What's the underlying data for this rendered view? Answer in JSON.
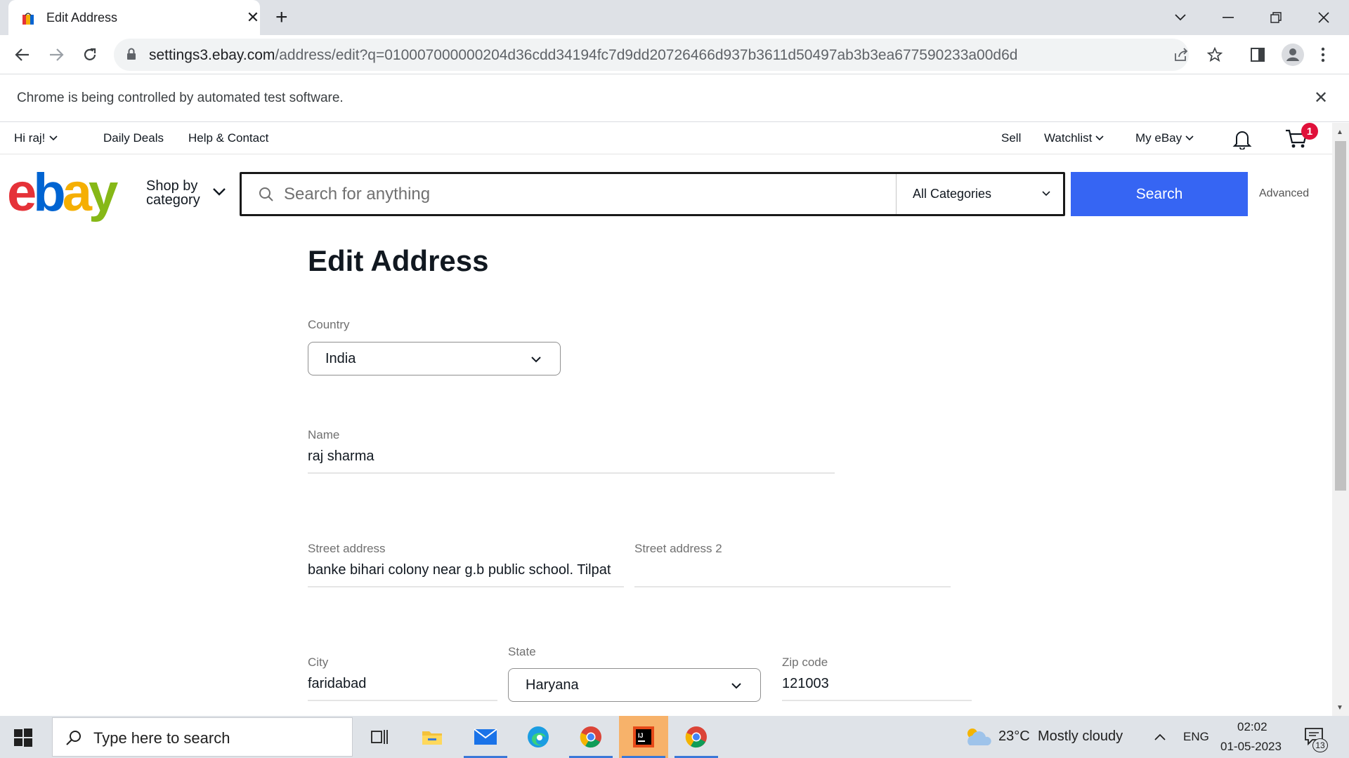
{
  "browser": {
    "tab_title": "Edit Address",
    "url_host": "settings3.ebay.com",
    "url_path": "/address/edit?q=010007000000204d36cdd34194fc7d9dd20726466d937b3611d50497ab3b3ea677590233a00d6d",
    "infobar_text": "Chrome is being controlled by automated test software."
  },
  "ebay_header": {
    "greeting": "Hi raj!",
    "links": [
      "Daily Deals",
      "Help & Contact"
    ],
    "right_links": [
      "Sell",
      "Watchlist",
      "My eBay"
    ],
    "cart_count": "1",
    "logo_letters": [
      "e",
      "b",
      "a",
      "y"
    ],
    "logo_colors": [
      "#e53238",
      "#0064d2",
      "#f5af02",
      "#86b817"
    ],
    "shop_by_line1": "Shop by",
    "shop_by_line2": "category",
    "search_placeholder": "Search for anything",
    "category_select": "All Categories",
    "search_button": "Search",
    "advanced_link": "Advanced"
  },
  "form": {
    "title": "Edit Address",
    "country": {
      "label": "Country",
      "value": "India"
    },
    "name": {
      "label": "Name",
      "value": "raj sharma"
    },
    "street1": {
      "label": "Street address",
      "value": "banke bihari colony near g.b public school. Tilpat"
    },
    "street2": {
      "label": "Street address 2",
      "value": ""
    },
    "city": {
      "label": "City",
      "value": "faridabad"
    },
    "state": {
      "label": "State",
      "value": "Haryana"
    },
    "zip": {
      "label": "Zip code",
      "value": "121003"
    }
  },
  "taskbar": {
    "search_placeholder": "Type here to search",
    "weather_temp": "23°C",
    "weather_text": "Mostly cloudy",
    "language": "ENG",
    "time": "02:02",
    "date": "01-05-2023",
    "notification_count": "13"
  },
  "colors": {
    "accent": "#3665f3",
    "cart_badge": "#e0103a"
  }
}
